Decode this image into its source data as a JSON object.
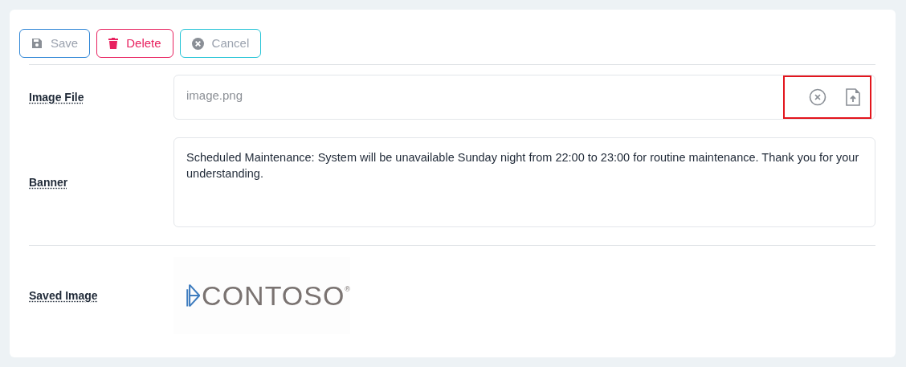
{
  "toolbar": [
    {
      "kind": "save",
      "label": "Save",
      "disabled": true
    },
    {
      "kind": "delete",
      "label": "Delete",
      "disabled": false
    },
    {
      "kind": "cancel",
      "label": "Cancel",
      "disabled": true
    }
  ],
  "fields": [
    {
      "kind": "file",
      "label": "Image File",
      "value": "image.png",
      "highlighted": true
    },
    {
      "kind": "textarea",
      "label": "Banner",
      "value": "Scheduled Maintenance: System will be unavailable Sunday night from 22:00 to 23:00 for routine maintenance. Thank you for your understanding."
    }
  ],
  "saved_image": {
    "label": "Saved Image",
    "logo_text": "CONTOSO",
    "logo_mark": "®"
  }
}
